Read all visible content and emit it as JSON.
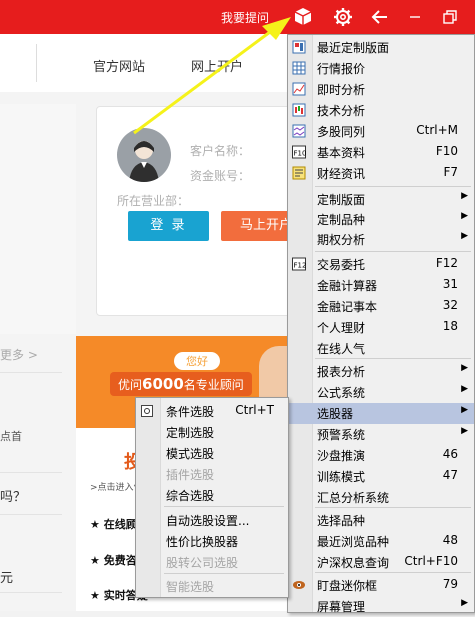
{
  "titlebar": {
    "ask_label": "我要提问",
    "icons": [
      "cube-icon",
      "gear-icon",
      "back-arrow-icon",
      "minimize-icon",
      "restore-icon"
    ],
    "bg_color": "#e61d1d"
  },
  "nav": {
    "links": [
      "官方网站",
      "网上开户"
    ]
  },
  "login": {
    "customer_name_label": "客户名称：",
    "account_label": "资金账号：",
    "branch_label": "所在营业部：",
    "login_button": "登 录",
    "open_button": "马上开户"
  },
  "left_column": {
    "more": "更多 >",
    "row1": "点首",
    "row2": "吗？",
    "row3": "元"
  },
  "promo": {
    "hello": "您好",
    "headline_prefix": "优问",
    "headline_number": "6000",
    "headline_suffix": "名专业顾问",
    "big_text": "投",
    "small_text": ">点击进入优",
    "items": [
      "★ 在线顾问",
      "★ 免费咨询",
      "★ 实时答疑"
    ]
  },
  "menu": {
    "items": [
      {
        "label": "最近定制版面",
        "shortcut": "",
        "icon": "layout-icon"
      },
      {
        "label": "行情报价",
        "shortcut": "",
        "icon": "grid-icon"
      },
      {
        "label": "即时分析",
        "shortcut": "",
        "icon": "line-chart-icon"
      },
      {
        "label": "技术分析",
        "shortcut": "",
        "icon": "candlestick-icon"
      },
      {
        "label": "多股同列",
        "shortcut": "Ctrl+M",
        "icon": "multi-chart-icon"
      },
      {
        "label": "基本资料",
        "shortcut": "F10",
        "icon": "f10-icon"
      },
      {
        "label": "财经资讯",
        "shortcut": "F7",
        "icon": "news-icon"
      },
      {
        "label": "定制版面",
        "shortcut": "",
        "submenu": true
      },
      {
        "label": "定制品种",
        "shortcut": "",
        "submenu": true
      },
      {
        "label": "期权分析",
        "shortcut": "",
        "submenu": true
      },
      {
        "label": "交易委托",
        "shortcut": "F12",
        "icon": "f12-icon"
      },
      {
        "label": "金融计算器",
        "shortcut": "31"
      },
      {
        "label": "金融记事本",
        "shortcut": "32"
      },
      {
        "label": "个人理财",
        "shortcut": "18"
      },
      {
        "label": "在线人气",
        "shortcut": ""
      },
      {
        "label": "报表分析",
        "shortcut": "",
        "submenu": true
      },
      {
        "label": "公式系统",
        "shortcut": "",
        "submenu": true
      },
      {
        "label": "选股器",
        "shortcut": "",
        "submenu": true,
        "highlighted": true
      },
      {
        "label": "预警系统",
        "shortcut": "",
        "submenu": true
      },
      {
        "label": "沙盘推演",
        "shortcut": "46"
      },
      {
        "label": "训练模式",
        "shortcut": "47"
      },
      {
        "label": "汇总分析系统",
        "shortcut": ""
      },
      {
        "label": "选择品种",
        "shortcut": ""
      },
      {
        "label": "最近浏览品种",
        "shortcut": "48"
      },
      {
        "label": "沪深权息查询",
        "shortcut": "Ctrl+F10"
      },
      {
        "label": "盯盘迷你框",
        "shortcut": "79",
        "icon": "eye-icon"
      },
      {
        "label": "屏幕管理",
        "shortcut": "",
        "submenu": true
      }
    ]
  },
  "submenu": {
    "items": [
      {
        "label": "条件选股",
        "shortcut": "Ctrl+T",
        "disabled": false
      },
      {
        "label": "定制选股",
        "shortcut": "",
        "disabled": false
      },
      {
        "label": "模式选股",
        "shortcut": "",
        "disabled": false
      },
      {
        "label": "插件选股",
        "shortcut": "",
        "disabled": true
      },
      {
        "label": "综合选股",
        "shortcut": "",
        "disabled": false
      },
      {
        "label": "自动选股设置...",
        "shortcut": "",
        "disabled": false
      },
      {
        "label": "性价比换股器",
        "shortcut": "",
        "disabled": false
      },
      {
        "label": "股转公司选股",
        "shortcut": "",
        "disabled": true
      },
      {
        "label": "智能选股",
        "shortcut": "",
        "disabled": true
      }
    ]
  }
}
